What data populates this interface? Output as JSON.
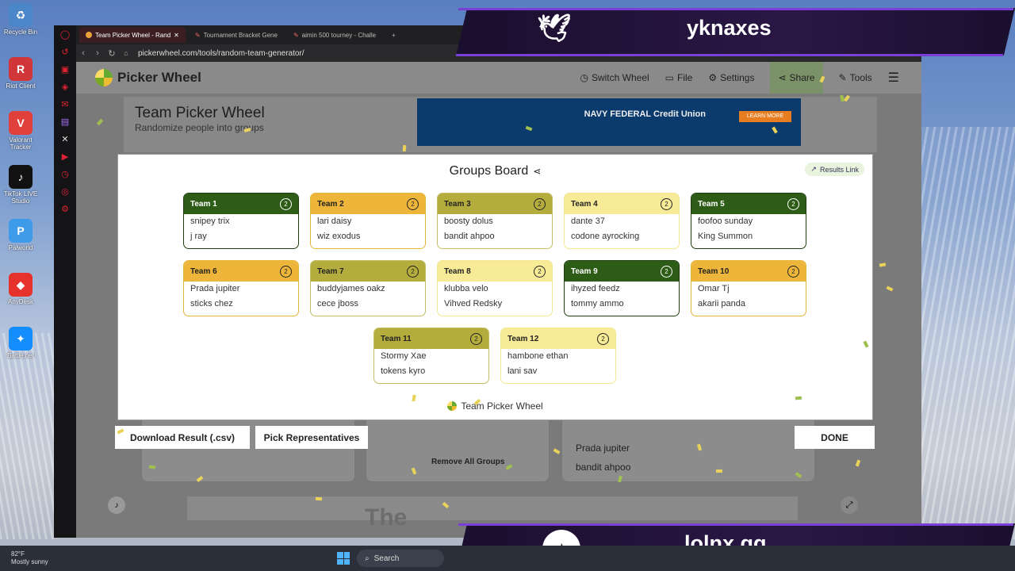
{
  "desktop": {
    "icons": [
      {
        "label": "Recycle Bin",
        "icon": "recycle-bin-icon",
        "color": "#4a86c8"
      },
      {
        "label": "Riot Client",
        "icon": "riot-client-icon",
        "color": "#d13639"
      },
      {
        "label": "Valorant Tracker",
        "icon": "valorant-tracker-icon",
        "color": "#e0403c"
      },
      {
        "label": "TikTok LIVE Studio",
        "icon": "tiktok-studio-icon",
        "color": "#111111"
      },
      {
        "label": "Palworld",
        "icon": "palworld-icon",
        "color": "#3d9be9"
      },
      {
        "label": "AnyDesk",
        "icon": "anydesk-icon",
        "color": "#e5322d"
      },
      {
        "label": "Battle.net",
        "icon": "battlenet-icon",
        "color": "#148eff"
      }
    ]
  },
  "browser": {
    "tabs": [
      {
        "label": "Team Picker Wheel - Rand",
        "active": true
      },
      {
        "label": "Tournament Bracket Gene",
        "active": false
      },
      {
        "label": "aimin 500 tourney - Challe",
        "active": false
      }
    ],
    "url": "pickerwheel.com/tools/random-team-generator/"
  },
  "site": {
    "logo_text": "Picker Wheel",
    "menu": {
      "switch_wheel": "Switch Wheel",
      "file": "File",
      "settings": "Settings",
      "share": "Share",
      "tools": "Tools"
    },
    "hero_title": "Team Picker Wheel",
    "hero_subtitle": "Randomize people into groups",
    "ad": {
      "brand": "NAVY FEDERAL Credit Union",
      "cta": "LEARN MORE"
    },
    "background": {
      "remove_all_groups": "Remove All Groups",
      "list_item_1": "Prada jupiter",
      "list_item_2": "bandit ahpoo",
      "bottom_title": "The"
    }
  },
  "modal": {
    "title": "Groups Board",
    "results_link": "Results Link",
    "footer": "Team Picker Wheel",
    "teams": [
      {
        "name": "Team 1",
        "style": "dg",
        "members": [
          "snipey trix",
          "j ray"
        ],
        "count_icon": "2"
      },
      {
        "name": "Team 2",
        "style": "or",
        "members": [
          "lari daisy",
          "wiz exodus"
        ],
        "count_icon": "2"
      },
      {
        "name": "Team 3",
        "style": "ol",
        "members": [
          "boosty dolus",
          "bandit ahpoo"
        ],
        "count_icon": "2"
      },
      {
        "name": "Team 4",
        "style": "ly",
        "members": [
          "dante 37",
          "codone ayrocking"
        ],
        "count_icon": "2"
      },
      {
        "name": "Team 5",
        "style": "dg",
        "members": [
          "foofoo sunday",
          "King Summon"
        ],
        "count_icon": "2"
      },
      {
        "name": "Team 6",
        "style": "or",
        "members": [
          "Prada jupiter",
          "sticks chez"
        ],
        "count_icon": "2"
      },
      {
        "name": "Team 7",
        "style": "ol",
        "members": [
          "buddyjames oakz",
          "cece jboss"
        ],
        "count_icon": "2"
      },
      {
        "name": "Team 8",
        "style": "ly",
        "members": [
          "klubba velo",
          "Vihved Redsky"
        ],
        "count_icon": "2"
      },
      {
        "name": "Team 9",
        "style": "dg",
        "members": [
          "ihyzed feedz",
          "tommy ammo"
        ],
        "count_icon": "2"
      },
      {
        "name": "Team 10",
        "style": "or",
        "members": [
          "Omar Tj",
          "akarii panda"
        ],
        "count_icon": "2"
      },
      {
        "name": "Team 11",
        "style": "ol",
        "members": [
          "Stormy Xae",
          "tokens kyro"
        ],
        "count_icon": "2"
      },
      {
        "name": "Team 12",
        "style": "ly",
        "members": [
          "hambone ethan",
          "lani sav"
        ],
        "count_icon": "2"
      }
    ]
  },
  "actions": {
    "download": "Download Result (.csv)",
    "pick_reps": "Pick Representatives",
    "done": "DONE"
  },
  "overlays": {
    "twitter_handle": "yknaxes",
    "tiktok_handle": "lolnx.gg"
  },
  "taskbar": {
    "weather_temp": "82°F",
    "weather_desc": "Mostly sunny",
    "search": "Search"
  },
  "colors": {
    "dark_green": "#2d5c17",
    "orange": "#edb63a",
    "olive": "#b4ad3e",
    "light_yellow": "#f7eb97",
    "overlay_purple": "#7a3fd6"
  }
}
